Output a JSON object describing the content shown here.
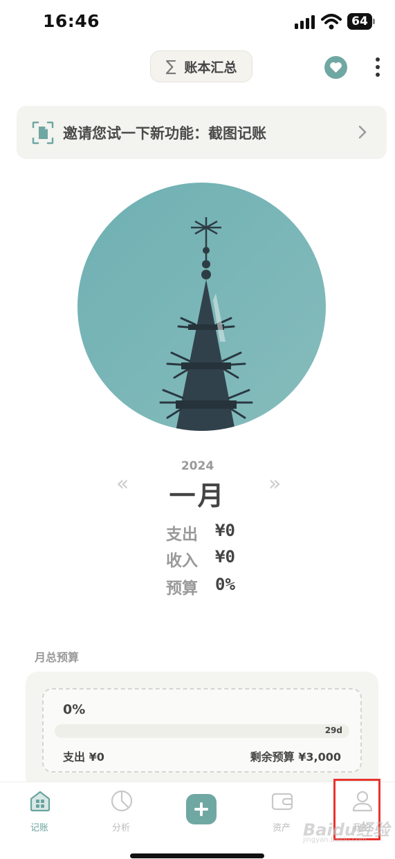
{
  "status_bar": {
    "time": "16:46",
    "battery": "64"
  },
  "header": {
    "ledger_label": "账本汇总",
    "ledger_icon": "sigma-icon"
  },
  "banner": {
    "text": "邀请您试一下新功能：截图记账"
  },
  "period": {
    "year": "2024",
    "month": "一月",
    "prev": "«",
    "next": "»"
  },
  "summary": [
    {
      "label": "支出",
      "value": "¥0"
    },
    {
      "label": "收入",
      "value": "¥0"
    },
    {
      "label": "预算",
      "value": "0%"
    }
  ],
  "budget": {
    "section_title": "月总预算",
    "percent_text": "0%",
    "progress_fraction": 0,
    "days_left": "29d",
    "spent": "支出 ¥0",
    "remaining": "剩余预算 ¥3,000"
  },
  "tabs": [
    {
      "label": "记账",
      "icon": "ledger-grid-icon",
      "active": true
    },
    {
      "label": "分析",
      "icon": "pie-chart-icon",
      "active": false
    },
    {
      "label": "",
      "icon": "plus-icon",
      "active": false
    },
    {
      "label": "资产",
      "icon": "wallet-icon",
      "active": false
    },
    {
      "label": "我的",
      "icon": "user-icon",
      "active": false
    }
  ],
  "watermark": {
    "text": "Baidu经验",
    "sub": "jingyan.baidu.com"
  },
  "colors": {
    "accent": "#6fa7a2",
    "highlight": "#e8332d",
    "sky": "#74b3b4"
  }
}
